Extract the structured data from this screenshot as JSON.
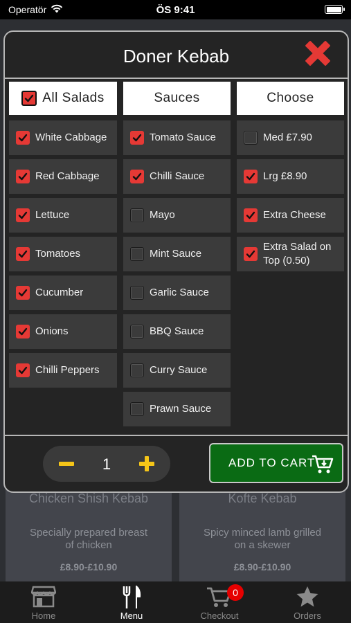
{
  "status_bar": {
    "carrier": "Operatör",
    "time": "ÖS 9:41"
  },
  "background_menu": [
    {
      "title": "Chicken Shish Kebab",
      "description": "Specially prepared breast of chicken",
      "price": "£8.90-£10.90"
    },
    {
      "title": "Kofte Kebab",
      "description": "Spicy minced lamb grilled on a skewer",
      "price": "£8.90-£10.90"
    }
  ],
  "modal": {
    "title": "Doner Kebab",
    "headers": {
      "salads": "All Salads",
      "salads_checked": true,
      "sauces": "Sauces",
      "choose": "Choose"
    },
    "salads": [
      {
        "label": "White Cabbage",
        "checked": true
      },
      {
        "label": "Red Cabbage",
        "checked": true
      },
      {
        "label": "Lettuce",
        "checked": true
      },
      {
        "label": "Tomatoes",
        "checked": true
      },
      {
        "label": "Cucumber",
        "checked": true
      },
      {
        "label": "Onions",
        "checked": true
      },
      {
        "label": "Chilli Peppers",
        "checked": true
      }
    ],
    "sauces": [
      {
        "label": "Tomato Sauce",
        "checked": true
      },
      {
        "label": "Chilli Sauce",
        "checked": true
      },
      {
        "label": "Mayo",
        "checked": false
      },
      {
        "label": "Mint Sauce",
        "checked": false
      },
      {
        "label": "Garlic Sauce",
        "checked": false
      },
      {
        "label": "BBQ Sauce",
        "checked": false
      },
      {
        "label": "Curry Sauce",
        "checked": false
      },
      {
        "label": "Prawn Sauce",
        "checked": false
      }
    ],
    "choose": [
      {
        "label": "Med £7.90",
        "checked": false
      },
      {
        "label": "Lrg £8.90",
        "checked": true
      },
      {
        "label": "Extra Cheese",
        "checked": true
      },
      {
        "label": "Extra Salad on Top (0.50)",
        "checked": true
      }
    ],
    "quantity": "1",
    "add_to_cart": "ADD TO CART"
  },
  "tab_bar": {
    "items": [
      {
        "label": "Home",
        "icon": "store-icon",
        "active": false
      },
      {
        "label": "Menu",
        "icon": "fork-knife-icon",
        "active": true
      },
      {
        "label": "Checkout",
        "icon": "cart-icon",
        "active": false
      },
      {
        "label": "Orders",
        "icon": "star-icon",
        "active": false
      }
    ],
    "cart_badge": "0"
  },
  "colors": {
    "accent_red": "#e53935",
    "cart_green": "#0a6b14",
    "stepper_yellow": "#f5c518"
  }
}
